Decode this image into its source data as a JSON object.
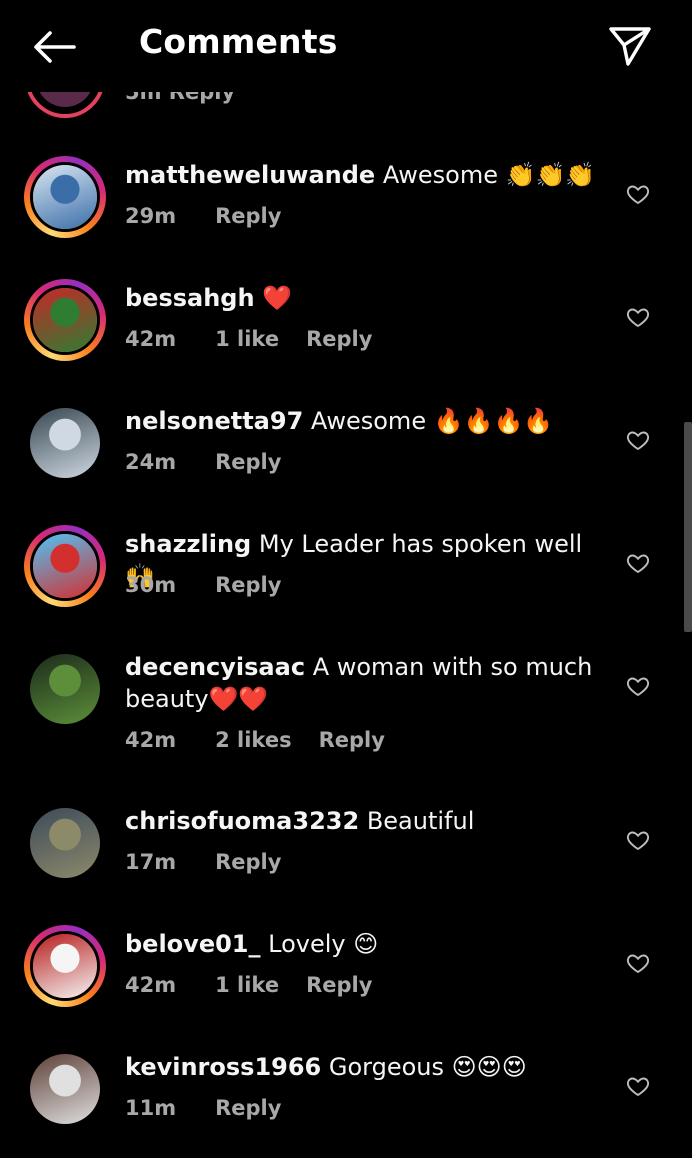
{
  "header": {
    "title": "Comments",
    "back_icon": "arrow-left-icon",
    "send_icon": "paper-plane-icon"
  },
  "partial": {
    "meta": "5m     Reply"
  },
  "comments": [
    {
      "username": "mattheweluwande",
      "text": "Awesome",
      "emoji": "👏👏👏",
      "time": "29m",
      "likes": "",
      "reply": "Reply",
      "story_ring": true,
      "avatar_colors": [
        "#3b6ea8",
        "#d9e6f2"
      ]
    },
    {
      "username": "bessahgh",
      "text": "",
      "emoji": "❤️",
      "time": "42m",
      "likes": "1 like",
      "reply": "Reply",
      "story_ring": true,
      "avatar_colors": [
        "#2e7d32",
        "#c62828"
      ]
    },
    {
      "username": "nelsonetta97",
      "text": "Awesome",
      "emoji": "🔥🔥🔥🔥",
      "time": "24m",
      "likes": "",
      "reply": "Reply",
      "story_ring": false,
      "avatar_colors": [
        "#cfd8e3",
        "#37474f"
      ]
    },
    {
      "username": "shazzling",
      "text": "My Leader has spoken well",
      "emoji": "🙌",
      "time": "30m",
      "likes": "",
      "reply": "Reply",
      "story_ring": true,
      "avatar_colors": [
        "#d32f2f",
        "#4fc3f7"
      ]
    },
    {
      "username": "decencyisaac",
      "text": "A woman with so much beauty",
      "emoji": "❤️❤️",
      "time": "42m",
      "likes": "2 likes",
      "reply": "Reply",
      "story_ring": false,
      "avatar_colors": [
        "#5d8f3a",
        "#1b2a1b"
      ]
    },
    {
      "username": "chrisofuoma3232",
      "text": "Beautiful",
      "emoji": "",
      "time": "17m",
      "likes": "",
      "reply": "Reply",
      "story_ring": false,
      "avatar_colors": [
        "#8d8a6a",
        "#3c4a5a"
      ]
    },
    {
      "username": "belove01_",
      "text": "Lovely",
      "emoji": "😊",
      "time": "42m",
      "likes": "1 like",
      "reply": "Reply",
      "story_ring": true,
      "avatar_colors": [
        "#f5f5f5",
        "#b71c1c"
      ]
    },
    {
      "username": "kevinross1966",
      "text": "Gorgeous",
      "emoji": "😍😍😍",
      "time": "11m",
      "likes": "",
      "reply": "Reply",
      "story_ring": false,
      "avatar_colors": [
        "#e0e0e0",
        "#5d4037"
      ]
    }
  ]
}
